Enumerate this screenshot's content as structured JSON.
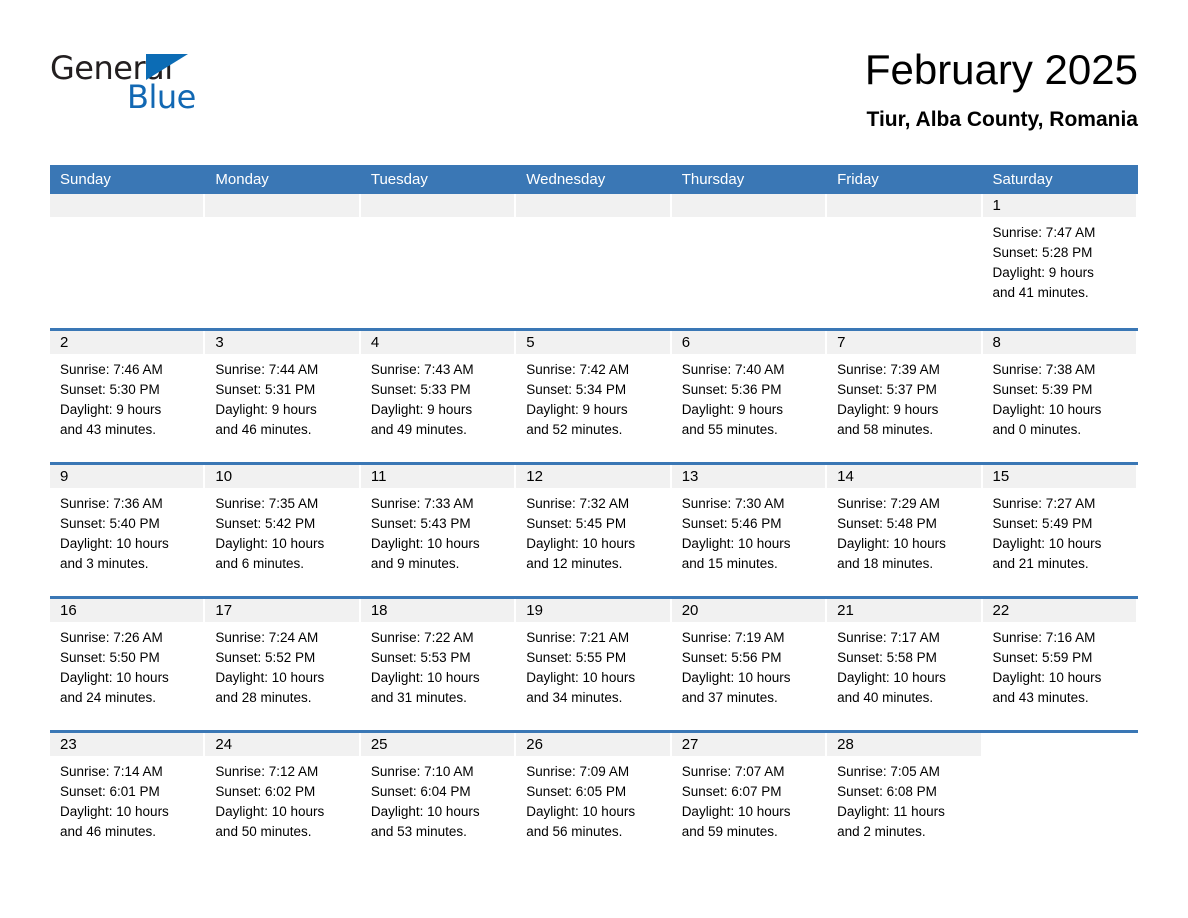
{
  "logo": {
    "word_one": "General",
    "word_two": "Blue",
    "triangle_color": "#0c6cb5",
    "blue_color": "#1268b3"
  },
  "header": {
    "month_title": "February 2025",
    "location": "Tiur, Alba County, Romania"
  },
  "theme": {
    "header_blue": "#3a77b5",
    "daynum_band": "#f1f1f1",
    "text": "#000000"
  },
  "calendar": {
    "weekdays": [
      "Sunday",
      "Monday",
      "Tuesday",
      "Wednesday",
      "Thursday",
      "Friday",
      "Saturday"
    ],
    "weeks": [
      [
        {
          "day": "",
          "lines": []
        },
        {
          "day": "",
          "lines": []
        },
        {
          "day": "",
          "lines": []
        },
        {
          "day": "",
          "lines": []
        },
        {
          "day": "",
          "lines": []
        },
        {
          "day": "",
          "lines": []
        },
        {
          "day": "1",
          "lines": [
            "Sunrise: 7:47 AM",
            "Sunset: 5:28 PM",
            "Daylight: 9 hours",
            "and 41 minutes."
          ]
        }
      ],
      [
        {
          "day": "2",
          "lines": [
            "Sunrise: 7:46 AM",
            "Sunset: 5:30 PM",
            "Daylight: 9 hours",
            "and 43 minutes."
          ]
        },
        {
          "day": "3",
          "lines": [
            "Sunrise: 7:44 AM",
            "Sunset: 5:31 PM",
            "Daylight: 9 hours",
            "and 46 minutes."
          ]
        },
        {
          "day": "4",
          "lines": [
            "Sunrise: 7:43 AM",
            "Sunset: 5:33 PM",
            "Daylight: 9 hours",
            "and 49 minutes."
          ]
        },
        {
          "day": "5",
          "lines": [
            "Sunrise: 7:42 AM",
            "Sunset: 5:34 PM",
            "Daylight: 9 hours",
            "and 52 minutes."
          ]
        },
        {
          "day": "6",
          "lines": [
            "Sunrise: 7:40 AM",
            "Sunset: 5:36 PM",
            "Daylight: 9 hours",
            "and 55 minutes."
          ]
        },
        {
          "day": "7",
          "lines": [
            "Sunrise: 7:39 AM",
            "Sunset: 5:37 PM",
            "Daylight: 9 hours",
            "and 58 minutes."
          ]
        },
        {
          "day": "8",
          "lines": [
            "Sunrise: 7:38 AM",
            "Sunset: 5:39 PM",
            "Daylight: 10 hours",
            "and 0 minutes."
          ]
        }
      ],
      [
        {
          "day": "9",
          "lines": [
            "Sunrise: 7:36 AM",
            "Sunset: 5:40 PM",
            "Daylight: 10 hours",
            "and 3 minutes."
          ]
        },
        {
          "day": "10",
          "lines": [
            "Sunrise: 7:35 AM",
            "Sunset: 5:42 PM",
            "Daylight: 10 hours",
            "and 6 minutes."
          ]
        },
        {
          "day": "11",
          "lines": [
            "Sunrise: 7:33 AM",
            "Sunset: 5:43 PM",
            "Daylight: 10 hours",
            "and 9 minutes."
          ]
        },
        {
          "day": "12",
          "lines": [
            "Sunrise: 7:32 AM",
            "Sunset: 5:45 PM",
            "Daylight: 10 hours",
            "and 12 minutes."
          ]
        },
        {
          "day": "13",
          "lines": [
            "Sunrise: 7:30 AM",
            "Sunset: 5:46 PM",
            "Daylight: 10 hours",
            "and 15 minutes."
          ]
        },
        {
          "day": "14",
          "lines": [
            "Sunrise: 7:29 AM",
            "Sunset: 5:48 PM",
            "Daylight: 10 hours",
            "and 18 minutes."
          ]
        },
        {
          "day": "15",
          "lines": [
            "Sunrise: 7:27 AM",
            "Sunset: 5:49 PM",
            "Daylight: 10 hours",
            "and 21 minutes."
          ]
        }
      ],
      [
        {
          "day": "16",
          "lines": [
            "Sunrise: 7:26 AM",
            "Sunset: 5:50 PM",
            "Daylight: 10 hours",
            "and 24 minutes."
          ]
        },
        {
          "day": "17",
          "lines": [
            "Sunrise: 7:24 AM",
            "Sunset: 5:52 PM",
            "Daylight: 10 hours",
            "and 28 minutes."
          ]
        },
        {
          "day": "18",
          "lines": [
            "Sunrise: 7:22 AM",
            "Sunset: 5:53 PM",
            "Daylight: 10 hours",
            "and 31 minutes."
          ]
        },
        {
          "day": "19",
          "lines": [
            "Sunrise: 7:21 AM",
            "Sunset: 5:55 PM",
            "Daylight: 10 hours",
            "and 34 minutes."
          ]
        },
        {
          "day": "20",
          "lines": [
            "Sunrise: 7:19 AM",
            "Sunset: 5:56 PM",
            "Daylight: 10 hours",
            "and 37 minutes."
          ]
        },
        {
          "day": "21",
          "lines": [
            "Sunrise: 7:17 AM",
            "Sunset: 5:58 PM",
            "Daylight: 10 hours",
            "and 40 minutes."
          ]
        },
        {
          "day": "22",
          "lines": [
            "Sunrise: 7:16 AM",
            "Sunset: 5:59 PM",
            "Daylight: 10 hours",
            "and 43 minutes."
          ]
        }
      ],
      [
        {
          "day": "23",
          "lines": [
            "Sunrise: 7:14 AM",
            "Sunset: 6:01 PM",
            "Daylight: 10 hours",
            "and 46 minutes."
          ]
        },
        {
          "day": "24",
          "lines": [
            "Sunrise: 7:12 AM",
            "Sunset: 6:02 PM",
            "Daylight: 10 hours",
            "and 50 minutes."
          ]
        },
        {
          "day": "25",
          "lines": [
            "Sunrise: 7:10 AM",
            "Sunset: 6:04 PM",
            "Daylight: 10 hours",
            "and 53 minutes."
          ]
        },
        {
          "day": "26",
          "lines": [
            "Sunrise: 7:09 AM",
            "Sunset: 6:05 PM",
            "Daylight: 10 hours",
            "and 56 minutes."
          ]
        },
        {
          "day": "27",
          "lines": [
            "Sunrise: 7:07 AM",
            "Sunset: 6:07 PM",
            "Daylight: 10 hours",
            "and 59 minutes."
          ]
        },
        {
          "day": "28",
          "lines": [
            "Sunrise: 7:05 AM",
            "Sunset: 6:08 PM",
            "Daylight: 11 hours",
            "and 2 minutes."
          ]
        },
        {
          "day": "",
          "lines": []
        }
      ]
    ]
  }
}
